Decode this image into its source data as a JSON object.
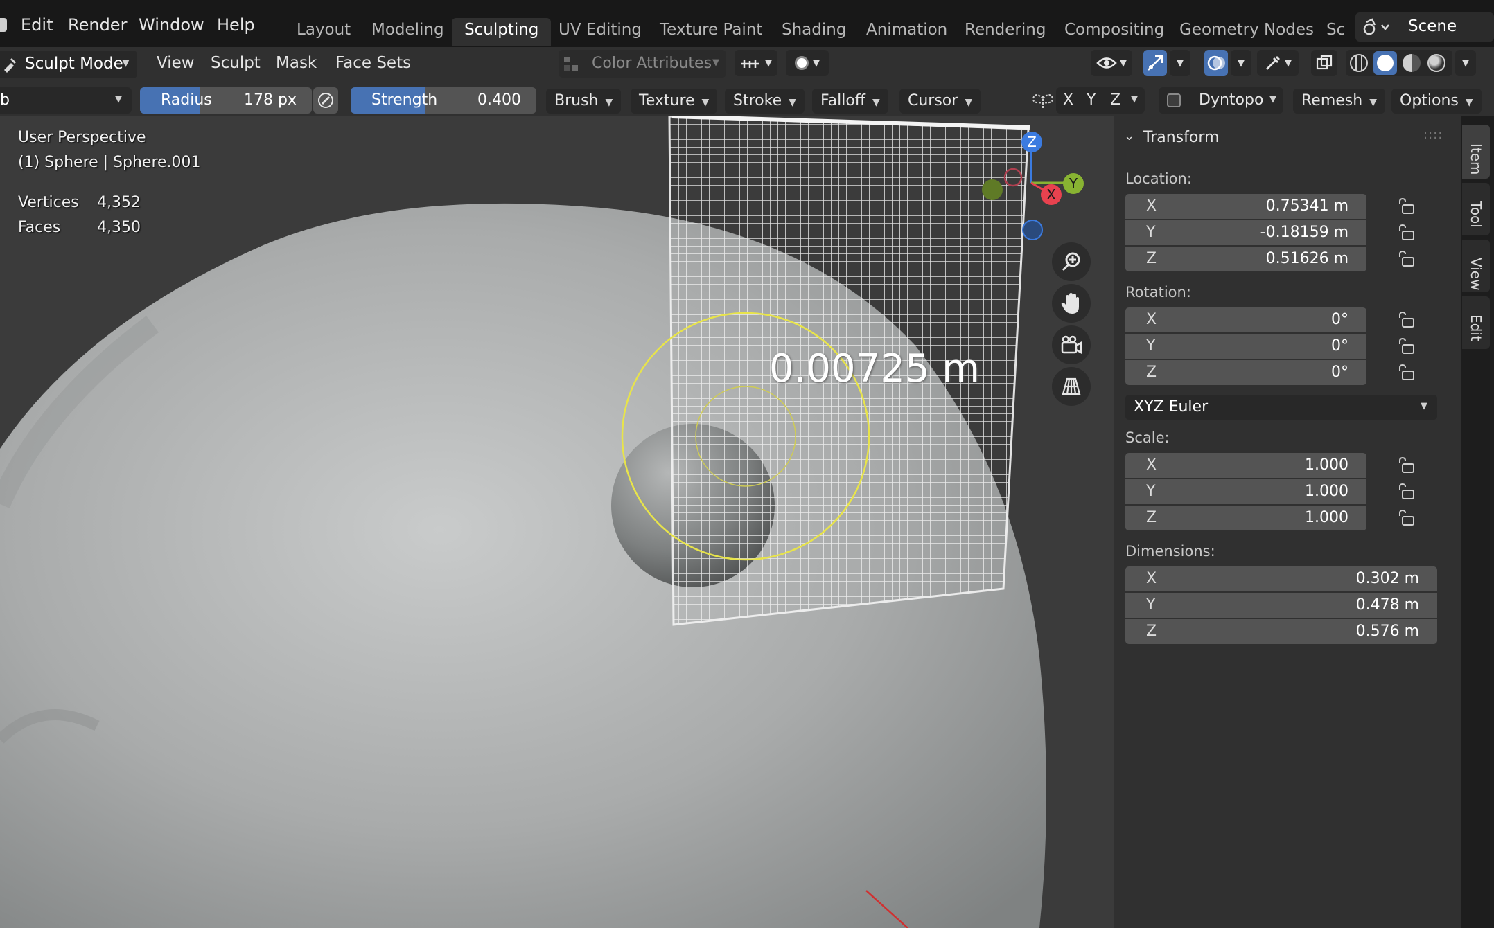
{
  "menubar": {
    "items": [
      "Edit",
      "Render",
      "Window",
      "Help"
    ],
    "workspaces": [
      "Layout",
      "Modeling",
      "Sculpting",
      "UV Editing",
      "Texture Paint",
      "Shading",
      "Animation",
      "Rendering",
      "Compositing",
      "Geometry Nodes",
      "Sc"
    ],
    "active_workspace": "Sculpting",
    "scene": "Scene"
  },
  "header1": {
    "mode": "Sculpt Mode",
    "menus": [
      "View",
      "Sculpt",
      "Mask",
      "Face Sets"
    ],
    "color_attributes": "Color Attributes"
  },
  "header2": {
    "brush_name": "b",
    "radius_label": "Radius",
    "radius_value": "178 px",
    "radius_fill": 0.35,
    "strength_label": "Strength",
    "strength_value": "0.400",
    "strength_fill": 0.4,
    "dropdowns": [
      "Brush",
      "Texture",
      "Stroke",
      "Falloff",
      "Cursor"
    ],
    "symmetry": [
      "X",
      "Y",
      "Z"
    ],
    "dyntopo": "Dyntopo",
    "remesh": "Remesh",
    "options": "Options"
  },
  "viewport": {
    "perspective": "User Perspective",
    "object": "(1) Sphere | Sphere.001",
    "stats": [
      {
        "label": "Vertices",
        "value": "4,352"
      },
      {
        "label": "Faces",
        "value": "4,350"
      }
    ],
    "measurement": "0.00725 m",
    "gizmo_axes": {
      "x": "X",
      "y": "Y",
      "z": "Z"
    },
    "colors": {
      "x_axis": "#e8424f",
      "y_axis": "#88b332",
      "z_axis": "#3b7be0",
      "brush_circle": "#e8e44a"
    }
  },
  "sidebar": {
    "panel_title": "Transform",
    "location_label": "Location:",
    "location": [
      {
        "axis": "X",
        "value": "0.75341 m"
      },
      {
        "axis": "Y",
        "value": "-0.18159 m"
      },
      {
        "axis": "Z",
        "value": "0.51626 m"
      }
    ],
    "rotation_label": "Rotation:",
    "rotation": [
      {
        "axis": "X",
        "value": "0°"
      },
      {
        "axis": "Y",
        "value": "0°"
      },
      {
        "axis": "Z",
        "value": "0°"
      }
    ],
    "rotation_mode": "XYZ Euler",
    "scale_label": "Scale:",
    "scale": [
      {
        "axis": "X",
        "value": "1.000"
      },
      {
        "axis": "Y",
        "value": "1.000"
      },
      {
        "axis": "Z",
        "value": "1.000"
      }
    ],
    "dimensions_label": "Dimensions:",
    "dimensions": [
      {
        "axis": "X",
        "value": "0.302 m"
      },
      {
        "axis": "Y",
        "value": "0.478 m"
      },
      {
        "axis": "Z",
        "value": "0.576 m"
      }
    ],
    "tabs": [
      "Item",
      "Tool",
      "View",
      "Edit"
    ],
    "active_tab": "Item"
  }
}
